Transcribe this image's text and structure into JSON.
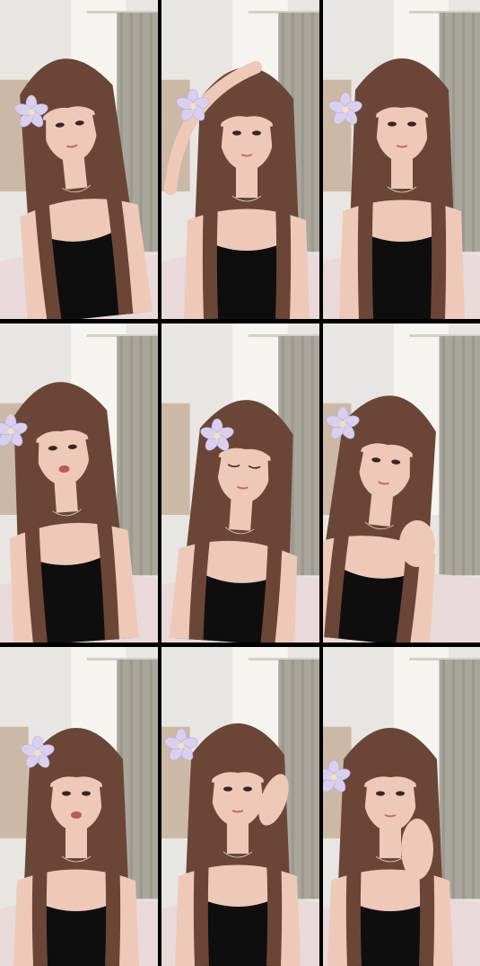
{
  "collage": {
    "rows": 3,
    "columns": 3,
    "tiles": [
      {
        "pose": "head-tilt-smile",
        "flower_side": "left",
        "hand": "none"
      },
      {
        "pose": "hand-on-head",
        "flower_side": "left",
        "hand": "head"
      },
      {
        "pose": "neutral",
        "flower_side": "left",
        "hand": "none"
      },
      {
        "pose": "talking",
        "flower_side": "left",
        "hand": "none"
      },
      {
        "pose": "eyes-closed",
        "flower_side": "left",
        "hand": "none"
      },
      {
        "pose": "touching-chest",
        "flower_side": "left",
        "hand": "chest"
      },
      {
        "pose": "talking-smile",
        "flower_side": "left",
        "hand": "none"
      },
      {
        "pose": "hand-near-face",
        "flower_side": "left",
        "hand": "face-right"
      },
      {
        "pose": "finger-to-lips",
        "flower_side": "left",
        "hand": "mouth"
      }
    ]
  },
  "colors": {
    "background": "#000000",
    "wall": "#e8e6e2",
    "curtain": "#a9a69c",
    "hair": "#6b4636",
    "skin": "#efc9b8",
    "top": "#0e0e0f",
    "flower": "#d9d0f0"
  }
}
